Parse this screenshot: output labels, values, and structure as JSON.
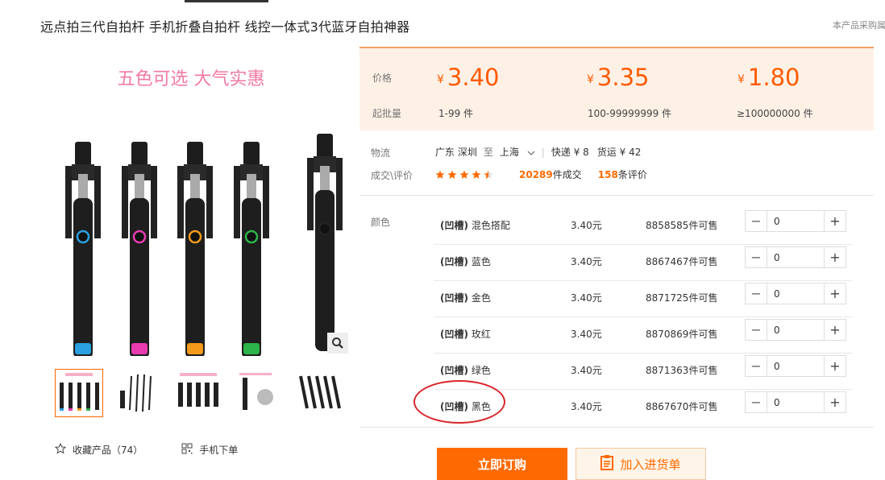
{
  "product": {
    "title": "远点拍三代自拍杆 手机折叠自拍杆 线控一体式3代蓝牙自拍神器",
    "note": "本产品采购属",
    "banner_text": "五色可选  大气实惠"
  },
  "prices": {
    "price_label": "价格",
    "qty_label": "起批量",
    "currency": "¥",
    "tiers": [
      {
        "price": "3.40",
        "qty": "1-99 件"
      },
      {
        "price": "3.35",
        "qty": "100-99999999 件"
      },
      {
        "price": "1.80",
        "qty": "≥100000000 件"
      }
    ]
  },
  "logistics": {
    "label": "物流",
    "from": "广东 深圳",
    "to_word": "至",
    "to": "上海",
    "express": "快递 ¥ 8",
    "freight": "货运 ¥ 42"
  },
  "review": {
    "label": "成交\\评价",
    "stars": 4.5,
    "deals_count": "20289",
    "deals_suffix": "件成交",
    "review_count": "158",
    "review_suffix": "条评价"
  },
  "sku": {
    "label": "颜色",
    "rows": [
      {
        "prefix": "(凹槽)",
        "color": "混色搭配",
        "price": "3.40元",
        "stock": "8858585件可售",
        "qty": "0"
      },
      {
        "prefix": "(凹槽)",
        "color": "蓝色",
        "price": "3.40元",
        "stock": "8867467件可售",
        "qty": "0"
      },
      {
        "prefix": "(凹槽)",
        "color": "金色",
        "price": "3.40元",
        "stock": "8871725件可售",
        "qty": "0"
      },
      {
        "prefix": "(凹槽)",
        "color": "玫红",
        "price": "3.40元",
        "stock": "8870869件可售",
        "qty": "0"
      },
      {
        "prefix": "(凹槽)",
        "color": "绿色",
        "price": "3.40元",
        "stock": "8871363件可售",
        "qty": "0"
      },
      {
        "prefix": "(凹槽)",
        "color": "黑色",
        "price": "3.40元",
        "stock": "8867670件可售",
        "qty": "0"
      }
    ]
  },
  "actions": {
    "favorite": "收藏产品（74）",
    "mobile": "手机下单",
    "buy": "立即订购",
    "cart": "加入进货单"
  },
  "colors": {
    "accent": "#ff6a00",
    "price": "#ff5a00",
    "panel_bg": "#fdf1e6",
    "highlight_ring": "#d9262c",
    "stick_rings": [
      "#2aa0e0",
      "#e83bb0",
      "#f39a1a",
      "#2db44a",
      "#222222"
    ]
  }
}
